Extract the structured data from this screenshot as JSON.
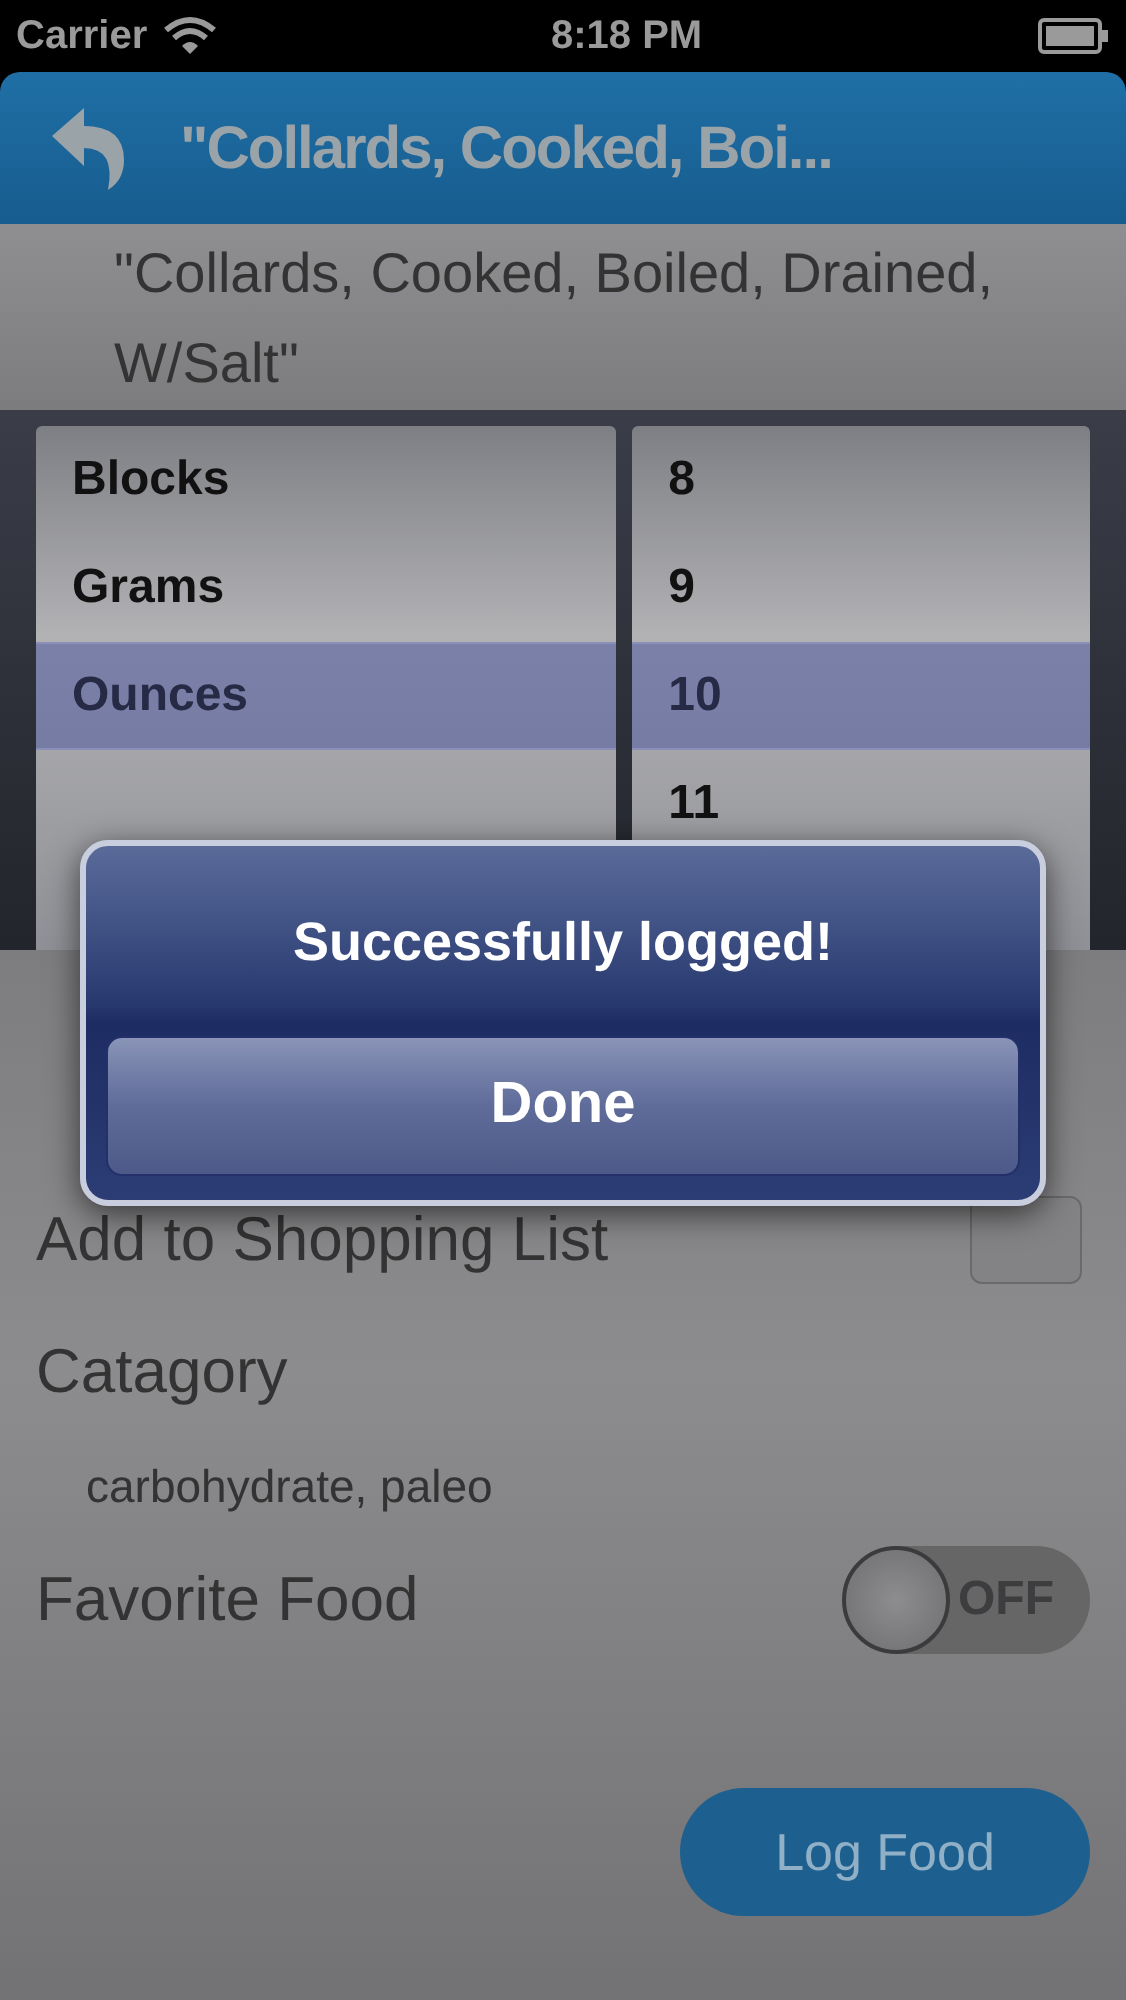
{
  "status_bar": {
    "carrier": "Carrier",
    "time": "8:18 PM"
  },
  "nav_bar": {
    "title": "\"Collards, Cooked, Boi..."
  },
  "food_name": "\"Collards, Cooked, Boiled, Drained, W/Salt\"",
  "picker": {
    "columns": [
      {
        "rows": [
          {
            "label": "Blocks",
            "selected": false
          },
          {
            "label": "Grams",
            "selected": false
          },
          {
            "label": "Ounces",
            "selected": true
          }
        ]
      },
      {
        "rows": [
          {
            "label": "8",
            "selected": false
          },
          {
            "label": "9",
            "selected": false
          },
          {
            "label": "10",
            "selected": true
          },
          {
            "label": "11",
            "selected": false
          }
        ]
      }
    ]
  },
  "options": [
    {
      "kind": "checkbox",
      "label": "Add to Shopping List",
      "checked": false
    },
    {
      "kind": "text",
      "label": "Catagory",
      "value": "carbohydrate, paleo"
    },
    {
      "kind": "switch",
      "label": "Favorite Food",
      "on": false,
      "state_label": "OFF"
    }
  ],
  "alert": {
    "message": "Successfully logged!",
    "button": "Done"
  },
  "log_button": "Log Food"
}
